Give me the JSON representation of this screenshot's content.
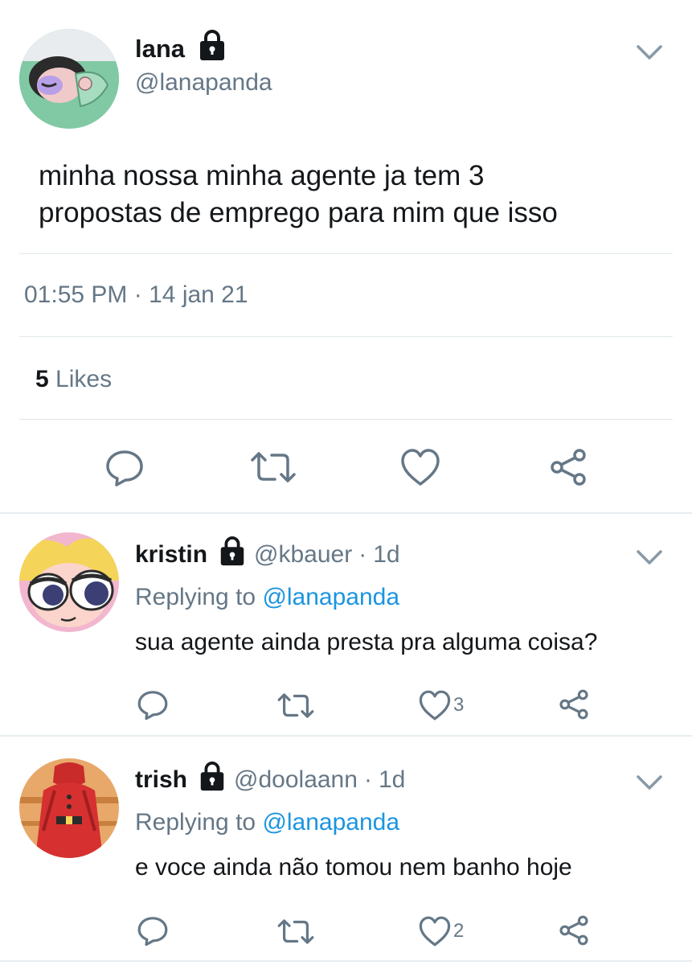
{
  "main_tweet": {
    "display_name": "lana",
    "handle": "@lanapanda",
    "text_line1": "minha nossa minha agente ja tem 3",
    "text_line2": "propostas de emprego para mim que isso",
    "time": "01:55 PM",
    "date_separator": "·",
    "date": "14 jan 21",
    "likes_count": "5",
    "likes_label": "Likes",
    "icons": [
      "reply-icon",
      "retweet-icon",
      "like-icon",
      "share-icon"
    ]
  },
  "replies": [
    {
      "display_name": "kristin",
      "handle": "@kbauer",
      "separator": "·",
      "age": "1d",
      "replying_prefix": "Replying to",
      "replying_handle": "@lanapanda",
      "text": "sua agente ainda presta pra alguma coisa?",
      "like_count": "3"
    },
    {
      "display_name": "trish",
      "handle": "@doolaann",
      "separator": "·",
      "age": "1d",
      "replying_prefix": "Replying to",
      "replying_handle": "@lanapanda",
      "text": "e voce ainda não tomou nem banho hoje",
      "like_count": "2"
    }
  ],
  "colors": {
    "text": "#14171a",
    "secondary": "#657786",
    "link": "#1b95e0",
    "divider": "#e1e8ed",
    "icon": "#657786"
  }
}
